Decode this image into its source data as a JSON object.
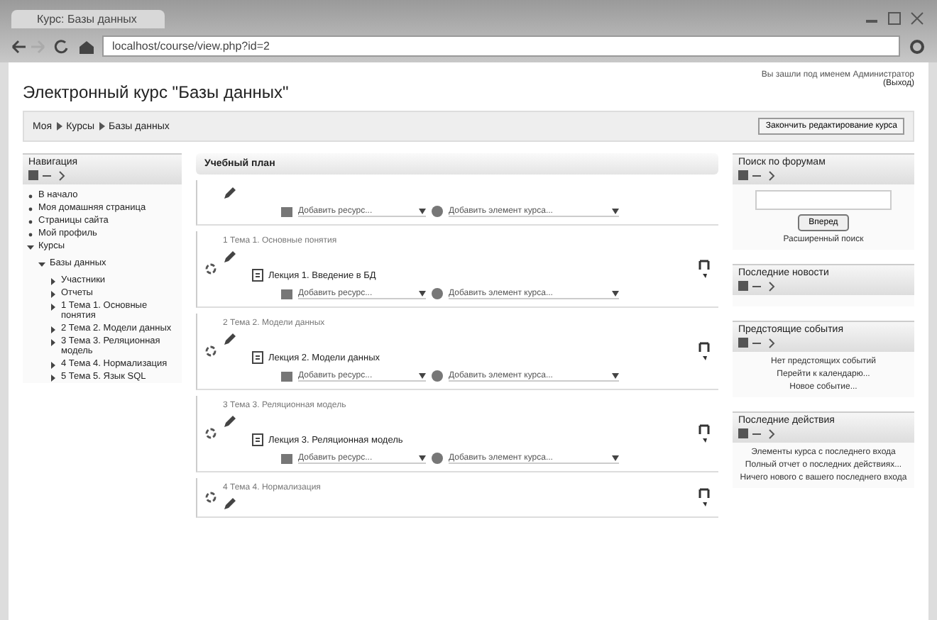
{
  "browser": {
    "tab_title": "Курс: Базы данных",
    "address": "localhost/course/view.php?id=2"
  },
  "header": {
    "title": "Электронный курс \"Базы данных\"",
    "login_info": "Вы зашли под именем Администратор",
    "logout": "(Выход)"
  },
  "breadcrumb": {
    "items": [
      "Моя",
      "Курсы",
      "Базы данных"
    ],
    "edit_button": "Закончить редактирование курса"
  },
  "navigation": {
    "title": "Навигация",
    "items": [
      {
        "label": "В начало",
        "expanded": false
      },
      {
        "label": "Моя домашняя страница",
        "expanded": false
      },
      {
        "label": "Страницы сайта",
        "expanded": false
      },
      {
        "label": "Мой профиль",
        "expanded": false
      },
      {
        "label": "Курсы",
        "expanded": true,
        "children": [
          {
            "label": "Базы данных",
            "expanded": true,
            "children": [
              {
                "label": "Участники",
                "expanded": false
              },
              {
                "label": "Отчеты",
                "expanded": false
              },
              {
                "label": "1 Тема 1. Основные понятия",
                "expanded": false
              },
              {
                "label": "2 Тема 2. Модели данных",
                "expanded": false
              },
              {
                "label": "3 Тема 3. Реляционная модель",
                "expanded": false
              },
              {
                "label": "4 Тема 4. Нормализация",
                "expanded": false
              },
              {
                "label": "5 Тема 5. Язык SQL",
                "expanded": false
              }
            ]
          }
        ]
      }
    ]
  },
  "main": {
    "title": "Учебный план",
    "sections": [
      {
        "add_resource": "Добавить ресурс...",
        "add_activity": "Добавить элемент курса..."
      },
      {
        "title": "1 Тема 1. Основные понятия",
        "resource": "Лекция 1. Введение в БД",
        "add_resource": "Добавить ресурс...",
        "add_activity": "Добавить элемент курса..."
      },
      {
        "title": "2 Тема 2. Модели данных",
        "resource": "Лекция 2. Модели данных",
        "add_resource": "Добавить ресурс...",
        "add_activity": "Добавить элемент курса..."
      },
      {
        "title": "3 Тема 3. Реляционная модель",
        "resource": "Лекция 3. Реляционная модель",
        "add_resource": "Добавить ресурс...",
        "add_activity": "Добавить элемент курса..."
      },
      {
        "title": "4 Тема 4. Нормализация"
      }
    ]
  },
  "blocks": [
    {
      "kind": "search",
      "title": "Поиск по форумам",
      "button": "Вперед",
      "link": "Расширенный поиск"
    },
    {
      "kind": "text",
      "title": "Последние новости"
    },
    {
      "kind": "text",
      "title": "Предстоящие события",
      "lines": [
        "Нет предстоящих событий",
        "Перейти к календарю...",
        "Новое событие..."
      ]
    },
    {
      "kind": "text",
      "title": "Последние действия",
      "lines": [
        "Элементы курса с последнего входа",
        "Полный отчет о последних действиях...",
        "Ничего нового с вашего последнего входа"
      ]
    }
  ]
}
